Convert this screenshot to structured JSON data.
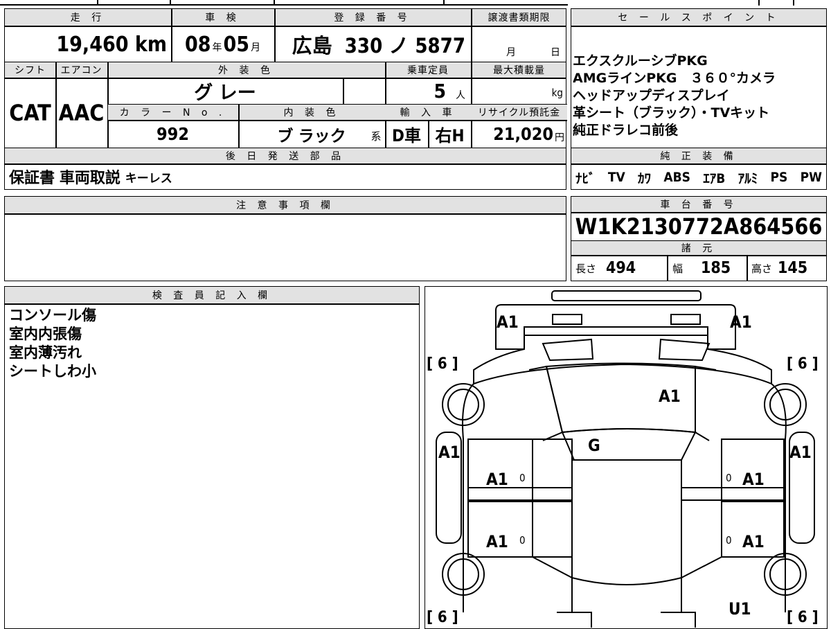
{
  "top": {
    "mileage_label": "走 行",
    "mileage": "19,460",
    "mileage_unit": "km",
    "inspection_label": "車 検",
    "inspection_year": "08",
    "year_unit": "年",
    "inspection_month": "05",
    "month_unit": "月",
    "registration_label": "登 録 番 号",
    "registration_area": "広島",
    "registration_number": "330 ノ 5877",
    "transfer_label": "譲渡書類期限",
    "transfer_month_unit": "月",
    "transfer_day_unit": "日"
  },
  "row2": {
    "shift_label": "シフト",
    "shift": "CAT",
    "ac_label": "エアコン",
    "ac": "AAC",
    "exterior_label": "外 装 色",
    "exterior": "グ レー",
    "capacity_label": "乗車定員",
    "capacity": "5",
    "capacity_unit": "人",
    "load_label": "最大積載量",
    "load_unit": "kg",
    "color_no_label": "カ ラ ー N o .",
    "color_no": "992",
    "interior_label": "内 装 色",
    "interior": "ブ ラック",
    "interior_suffix": "系",
    "import_label": "輸 入 車",
    "import_type": "D車",
    "handle": "右H",
    "recycle_label": "リサイクル預託金",
    "recycle": "21,020",
    "recycle_unit": "円"
  },
  "later_parts": {
    "label": "後 日 発 送 部 品",
    "value": "保証書 車両取説",
    "value_small": "キーレス"
  },
  "sales_points": {
    "label": "セ ー ル ス ポ イ ン ト",
    "lines": [
      "エクスクルーシブPKG",
      "AMGラインPKG　３６０°カメラ",
      "ヘッドアップディスプレイ",
      "革シート（ブラック）・TVキット",
      "純正ドラレコ前後"
    ]
  },
  "equipment": {
    "label": "純 正 装 備",
    "items": [
      "ﾅﾋﾞ",
      "TV",
      "ｶﾜ",
      "ABS",
      "ｴｱB",
      "ｱﾙﾐ",
      "PS",
      "PW"
    ]
  },
  "notes": {
    "label": "注 意 事 項 欄"
  },
  "chassis": {
    "label": "車 台 番 号",
    "value": "W1K2130772A864566"
  },
  "specs": {
    "label": "諸 元",
    "length_label": "長さ",
    "length": "494",
    "width_label": "幅",
    "width": "185",
    "height_label": "高さ",
    "height": "145"
  },
  "inspector": {
    "label": "検 査 員 記 入 欄",
    "lines": [
      "コンソール傷",
      "室内内張傷",
      "室内薄汚れ",
      "シートしわ小"
    ]
  },
  "diagram": {
    "marks": {
      "front_left": "A1",
      "front_right": "A1",
      "windshield": "A1",
      "roof": "G",
      "left_fender": "A1",
      "right_fender": "A1",
      "left_front_door": "A1",
      "right_front_door": "A1",
      "left_rear_door": "A1",
      "right_rear_door": "A1",
      "rear_right": "U1",
      "tire_fl": "[ 6 ]",
      "tire_fr": "[ 6 ]",
      "tire_rl": "[ 6 ]",
      "tire_rr": "[ 6 ]",
      "zero_lf": "0",
      "zero_rf": "0",
      "zero_lr": "0",
      "zero_rr": "0"
    }
  }
}
